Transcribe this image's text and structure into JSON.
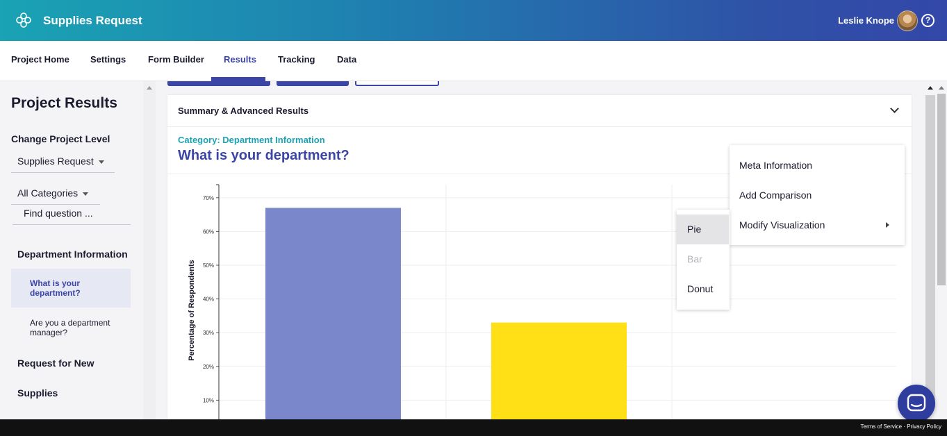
{
  "header": {
    "app_title": "Supplies Request",
    "user_name": "Leslie Knope",
    "help_glyph": "?",
    "logo_icon": "flower-logo-icon"
  },
  "nav": {
    "tabs": [
      {
        "label": "Project Home"
      },
      {
        "label": "Settings"
      },
      {
        "label": "Form Builder"
      },
      {
        "label": "Results",
        "active": true
      },
      {
        "label": "Tracking"
      },
      {
        "label": "Data"
      }
    ]
  },
  "sidebar": {
    "title": "Project Results",
    "change_level_label": "Change Project Level",
    "project_select": "Supplies Request",
    "category_select": "All Categories",
    "find_placeholder": "Find question ...",
    "sections": [
      {
        "label": "Department Information",
        "questions": [
          {
            "label": "What is your department?",
            "active": true
          },
          {
            "label": "Are you a department manager?"
          }
        ]
      },
      {
        "label": "Request for New"
      },
      {
        "label": "Supplies"
      }
    ]
  },
  "panel": {
    "title": "Summary & Advanced Results",
    "category": "Category: Department Information",
    "question": "What is your department?"
  },
  "context_menu": {
    "items": [
      {
        "label": "Meta Information"
      },
      {
        "label": "Add Comparison"
      },
      {
        "label": "Modify Visualization",
        "has_submenu": true
      }
    ],
    "submenu": [
      {
        "label": "Pie",
        "hovered": true
      },
      {
        "label": "Bar",
        "disabled": true
      },
      {
        "label": "Donut"
      }
    ]
  },
  "chart_data": {
    "type": "bar",
    "ylabel": "Percentage of Respondents",
    "yticks": [
      "70%",
      "60%",
      "50%",
      "40%",
      "30%",
      "20%",
      "10%"
    ],
    "ylim": [
      0,
      72
    ],
    "values": [
      67,
      33
    ],
    "colors": [
      "#7b87cb",
      "#ffe016"
    ],
    "grid": true
  },
  "footer": {
    "links": "Terms of Service · Privacy Policy"
  },
  "colors": {
    "accent": "#3a45a6",
    "teal": "#1aa3b4",
    "header_start": "#1aa3b4",
    "header_end": "#3347a8"
  }
}
